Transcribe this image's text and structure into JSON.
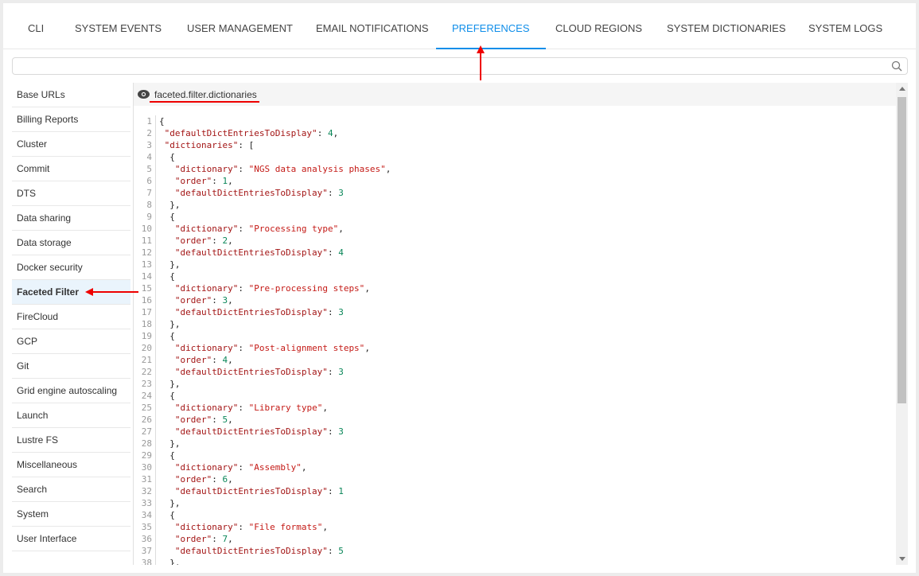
{
  "tabs": [
    "CLI",
    "SYSTEM EVENTS",
    "USER MANAGEMENT",
    "EMAIL NOTIFICATIONS",
    "PREFERENCES",
    "CLOUD REGIONS",
    "SYSTEM DICTIONARIES",
    "SYSTEM LOGS"
  ],
  "active_tab": "PREFERENCES",
  "search": {
    "value": "",
    "placeholder": ""
  },
  "sidebar": [
    "Base URLs",
    "Billing Reports",
    "Cluster",
    "Commit",
    "DTS",
    "Data sharing",
    "Data storage",
    "Docker security",
    "Faceted Filter",
    "FireCloud",
    "GCP",
    "Git",
    "Grid engine autoscaling",
    "Launch",
    "Lustre FS",
    "Miscellaneous",
    "Search",
    "System",
    "User Interface"
  ],
  "active_sidebar": "Faceted Filter",
  "editor": {
    "key": "faceted.filter.dictionaries",
    "lines": [
      "{",
      " \"defaultDictEntriesToDisplay\": 4,",
      " \"dictionaries\": [",
      "  {",
      "   \"dictionary\": \"NGS data analysis phases\",",
      "   \"order\": 1,",
      "   \"defaultDictEntriesToDisplay\": 3",
      "  },",
      "  {",
      "   \"dictionary\": \"Processing type\",",
      "   \"order\": 2,",
      "   \"defaultDictEntriesToDisplay\": 4",
      "  },",
      "  {",
      "   \"dictionary\": \"Pre-processing steps\",",
      "   \"order\": 3,",
      "   \"defaultDictEntriesToDisplay\": 3",
      "  },",
      "  {",
      "   \"dictionary\": \"Post-alignment steps\",",
      "   \"order\": 4,",
      "   \"defaultDictEntriesToDisplay\": 3",
      "  },",
      "  {",
      "   \"dictionary\": \"Library type\",",
      "   \"order\": 5,",
      "   \"defaultDictEntriesToDisplay\": 3",
      "  },",
      "  {",
      "   \"dictionary\": \"Assembly\",",
      "   \"order\": 6,",
      "   \"defaultDictEntriesToDisplay\": 1",
      "  },",
      "  {",
      "   \"dictionary\": \"File formats\",",
      "   \"order\": 7,",
      "   \"defaultDictEntriesToDisplay\": 5",
      "  },"
    ]
  },
  "colors": {
    "accent": "#108ee9",
    "annotation": "#e00000",
    "json_key": "#a31515",
    "json_string": "#c41a16",
    "json_number": "#098658"
  }
}
